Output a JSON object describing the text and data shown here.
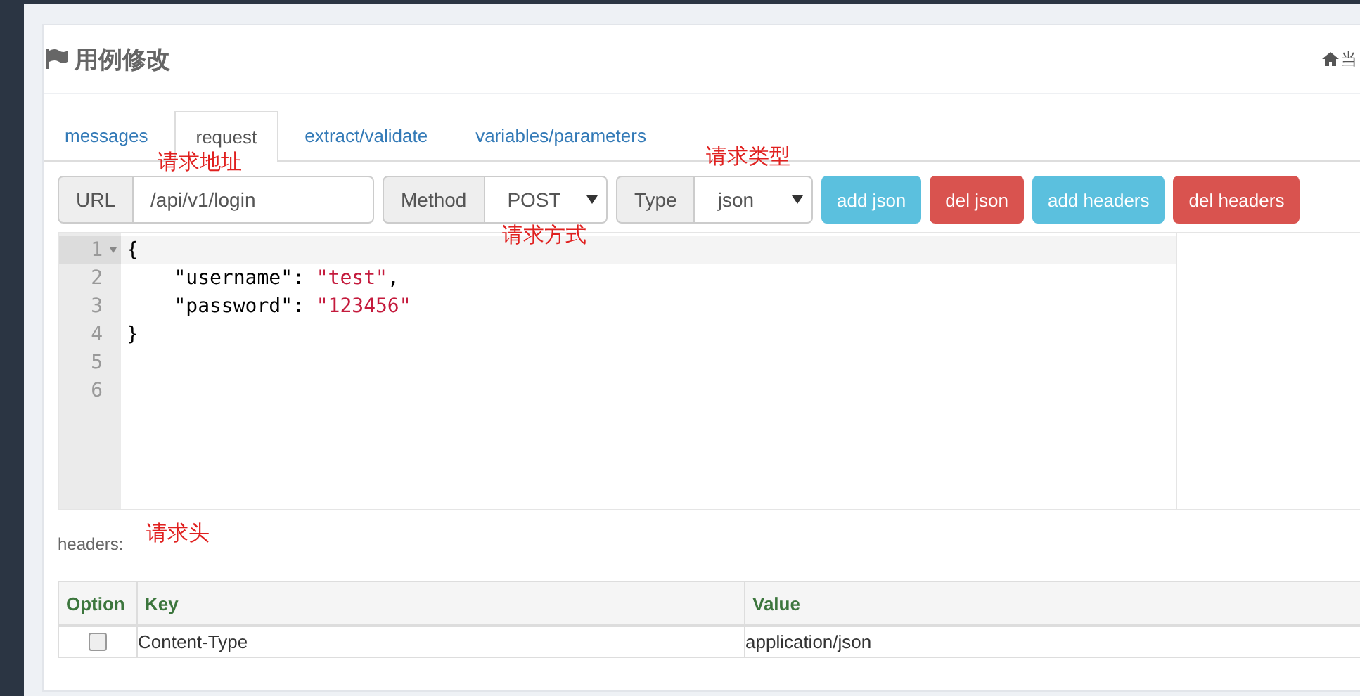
{
  "page_header": {
    "title": "用例修改",
    "breadcrumb": "当"
  },
  "tabs": [
    {
      "label": "messages",
      "selected": false
    },
    {
      "label": "request",
      "selected": true
    },
    {
      "label": "extract/validate",
      "selected": false
    },
    {
      "label": "variables/parameters",
      "selected": false
    }
  ],
  "request": {
    "url_label": "URL",
    "url": "/api/v1/login",
    "method_label": "Method",
    "method": "POST",
    "type_label": "Type",
    "type": "json"
  },
  "buttons": [
    {
      "label": "add json",
      "kind": "info"
    },
    {
      "label": "del json",
      "kind": "danger"
    },
    {
      "label": "add headers",
      "kind": "info"
    },
    {
      "label": "del headers",
      "kind": "danger"
    }
  ],
  "editor": {
    "lines": [
      {
        "number": "1",
        "active": true,
        "foldable": true,
        "tokens": [
          {
            "kind": "plain",
            "text": "{"
          }
        ]
      },
      {
        "number": "2",
        "active": false,
        "foldable": false,
        "tokens": [
          {
            "kind": "plain",
            "text": "    \"username\": "
          },
          {
            "kind": "string",
            "text": "\"test\""
          },
          {
            "kind": "plain",
            "text": ","
          }
        ]
      },
      {
        "number": "3",
        "active": false,
        "foldable": false,
        "tokens": [
          {
            "kind": "plain",
            "text": "    \"password\": "
          },
          {
            "kind": "string",
            "text": "\"123456\""
          }
        ]
      },
      {
        "number": "4",
        "active": false,
        "foldable": false,
        "tokens": [
          {
            "kind": "plain",
            "text": "}"
          }
        ]
      },
      {
        "number": "5",
        "active": false,
        "foldable": false
      },
      {
        "number": "6",
        "active": false,
        "foldable": false
      }
    ]
  },
  "headers": {
    "label": "headers:",
    "columns": [
      "Option",
      "Key",
      "Value"
    ],
    "rows": [
      {
        "checked": false,
        "key": "Content-Type",
        "value": "application/json"
      }
    ]
  },
  "annotations": [
    {
      "text": "请求地址"
    },
    {
      "text": "请求类型"
    },
    {
      "text": "请求方式"
    },
    {
      "text": "请求头"
    }
  ]
}
